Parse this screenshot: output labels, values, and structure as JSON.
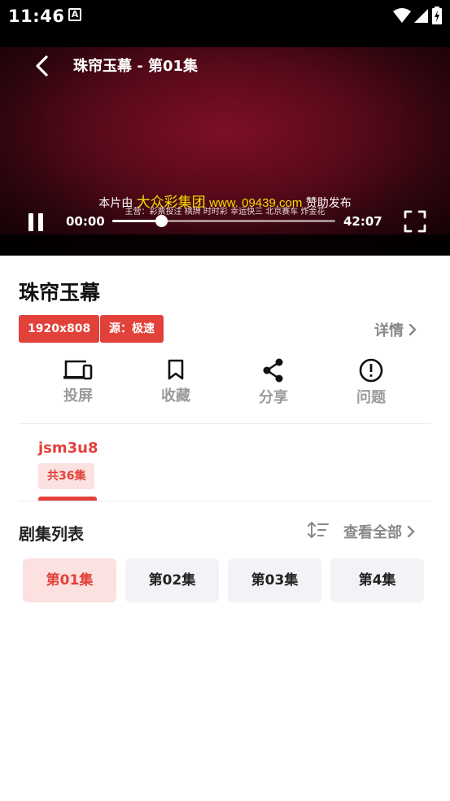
{
  "status_bar": {
    "time": "11:46",
    "notification_glyph": "A"
  },
  "player": {
    "title": "珠帘玉幕 - 第01集",
    "watermark": {
      "prefix": "本片由",
      "brand": "大众彩集团",
      "url": "www. 09439.com",
      "suffix": "赞助发布",
      "subline": "主营：彩票投注 棋牌 时时彩 幸运快三 北京赛车 炸金花"
    },
    "current_time": "00:00",
    "total_time": "42:07",
    "progress_fraction": 0.22
  },
  "info": {
    "title": "珠帘玉幕",
    "tags": {
      "resolution": "1920x808",
      "source": "源：极速"
    },
    "details_label": "详情"
  },
  "actions": [
    {
      "label": "投屏",
      "icon": "cast-screen-icon"
    },
    {
      "label": "收藏",
      "icon": "bookmark-icon"
    },
    {
      "label": "分享",
      "icon": "share-icon"
    },
    {
      "label": "问题",
      "icon": "alert-circle-icon"
    }
  ],
  "source": {
    "name": "jsm3u8",
    "count": "共36集"
  },
  "episodes": {
    "heading": "剧集列表",
    "view_all_label": "查看全部",
    "items": [
      {
        "label": "第01集",
        "active": true
      },
      {
        "label": "第02集",
        "active": false
      },
      {
        "label": "第03集",
        "active": false
      },
      {
        "label": "第4集",
        "active": false
      }
    ]
  },
  "colors": {
    "accent": "#e2413a",
    "accent_light": "#fbe1df",
    "muted_text": "#9a9a9a",
    "episode_bg": "#f2f3f6"
  }
}
